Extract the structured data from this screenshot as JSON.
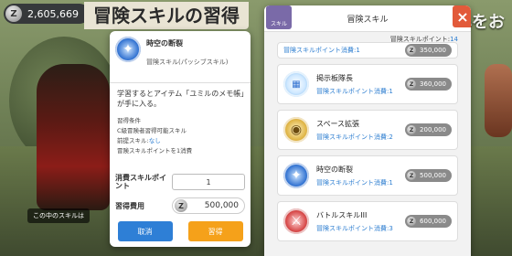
{
  "hud": {
    "currency_icon": "Z",
    "currency_value": "2,605,669",
    "screen_title": "冒険スキルの習得",
    "background_text": "心をお"
  },
  "popup": {
    "skill_name": "時空の断裂",
    "skill_type": "冒険スキル(パッシブスキル)",
    "description": "学習するとアイテム「ユミルのメモ帳」が手に入る。",
    "conditions_title": "習得条件",
    "condition_1": "C級冒険者習得可能スキル",
    "prereq_label": "前提スキル:",
    "prereq_value": "なし",
    "points_required": "冒険スキルポイントを1消費",
    "points_label": "消費スキルポイント",
    "points_value": "1",
    "cost_label": "習得費用",
    "cost_icon": "Z",
    "cost_value": "500,000",
    "cancel_label": "取消",
    "confirm_label": "習得"
  },
  "panel": {
    "tab_label": "スキル",
    "title": "冒険スキル",
    "points_label": "冒険スキルポイント:",
    "points_value": "14",
    "close_label": "×"
  },
  "skills": [
    {
      "name": "冒険スキルポイント消費:1",
      "points": "",
      "price": "350,000",
      "icon": "partial"
    },
    {
      "name": "掲示板隊長",
      "points": "冒険スキルポイント消費:1",
      "price": "360,000",
      "icon": "board-icon"
    },
    {
      "name": "スペース拡張",
      "points": "冒険スキルポイント消費:2",
      "price": "200,000",
      "icon": "space-icon"
    },
    {
      "name": "時空の断裂",
      "points": "冒険スキルポイント消費:1",
      "price": "500,000",
      "icon": "time-rift-icon"
    },
    {
      "name": "バトルスキルIII",
      "points": "冒険スキルポイント消費:3",
      "price": "600,000",
      "icon": "battle-icon"
    }
  ],
  "footnote": "この中のスキルは"
}
